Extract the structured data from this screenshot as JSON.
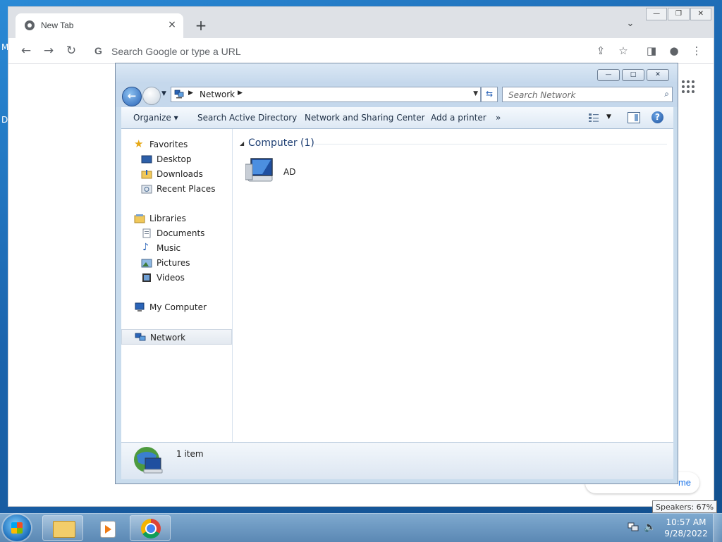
{
  "desktop": {
    "edge_m": "M",
    "edge_d": "D"
  },
  "browser": {
    "tab_title": "New Tab",
    "tab_close": "×",
    "new_tab": "+",
    "omnibox_placeholder": "Search Google or type a URL",
    "window_controls": {
      "minimize": "—",
      "restore": "❐",
      "close": "✕"
    },
    "customize_partial": "me"
  },
  "explorer": {
    "window_controls": {
      "minimize": "—",
      "maximize": "□",
      "close": "✕"
    },
    "address": {
      "path": "Network"
    },
    "search_placeholder": "Search Network",
    "commands": {
      "organize": "Organize ▾",
      "search_ad": "Search Active Directory",
      "network_sharing": "Network and Sharing Center",
      "add_printer": "Add a printer",
      "more": "»"
    },
    "nav": {
      "favorites": "Favorites",
      "desktop": "Desktop",
      "downloads": "Downloads",
      "recent": "Recent Places",
      "libraries": "Libraries",
      "documents": "Documents",
      "music": "Music",
      "pictures": "Pictures",
      "videos": "Videos",
      "my_computer": "My Computer",
      "network": "Network"
    },
    "group_heading": "Computer (1)",
    "items": [
      {
        "name": "AD"
      }
    ],
    "details_text": "1 item"
  },
  "taskbar": {
    "time": "10:57 AM",
    "date": "9/28/2022",
    "tooltip": "Speakers: 67%"
  },
  "colors": {
    "accent": "#1e3f73",
    "chrome_bar": "#dee1e6",
    "taskbar": "#5b88b4"
  }
}
